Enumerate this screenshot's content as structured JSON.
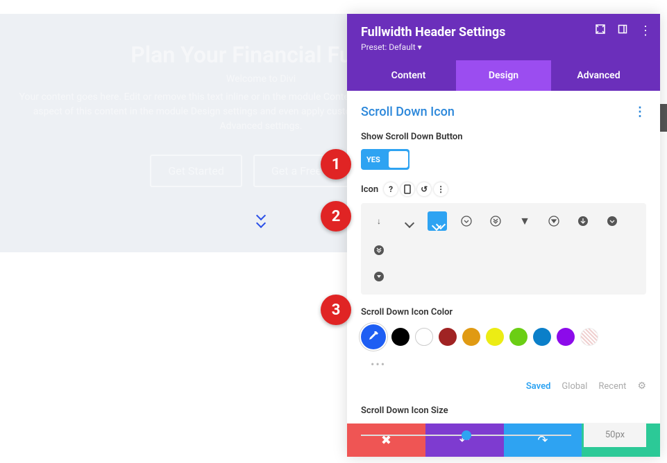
{
  "hero": {
    "title": "Plan Your Financial Future",
    "subtitle": "Welcome to Divi",
    "body": "Your content goes here. Edit or remove this text inline or in the module Content settings. You can also style every aspect of this content in the module Design settings and even apply custom CSS to this text in the module Advanced settings.",
    "btn1": "Get Started",
    "btn2": "Get a Free Quote"
  },
  "modal": {
    "title": "Fullwidth Header Settings",
    "preset": "Preset: Default",
    "tabs": {
      "content": "Content",
      "design": "Design",
      "advanced": "Advanced"
    },
    "section": "Scroll Down Icon",
    "show_label": "Show Scroll Down Button",
    "toggle_on": "YES",
    "icon_label": "Icon",
    "color_label": "Scroll Down Icon Color",
    "color_tabs": {
      "saved": "Saved",
      "global": "Global",
      "recent": "Recent"
    },
    "size_label": "Scroll Down Icon Size",
    "size_value": "50px"
  },
  "callouts": {
    "c1": "1",
    "c2": "2",
    "c3": "3"
  }
}
